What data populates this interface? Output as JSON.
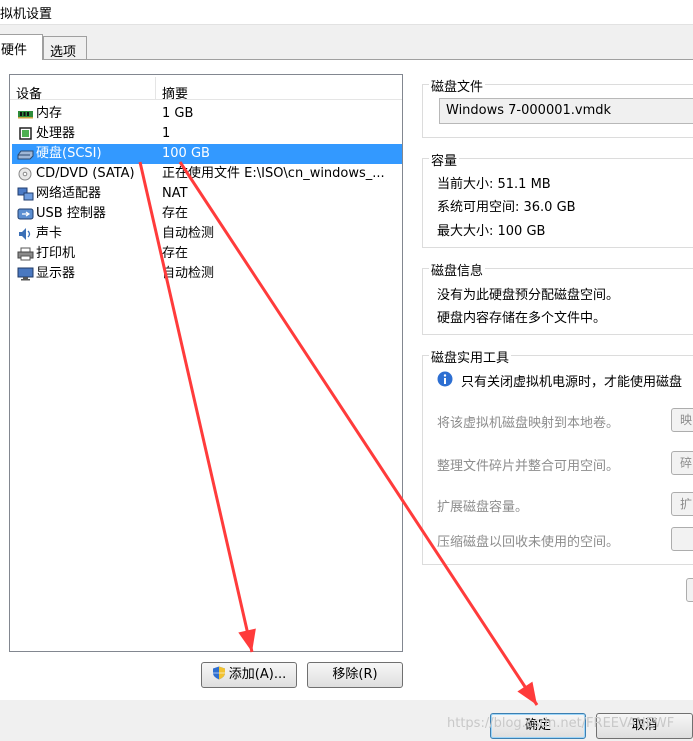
{
  "window": {
    "title": "拟机设置"
  },
  "tabs": [
    {
      "label": "硬件",
      "active": true
    },
    {
      "label": "选项",
      "active": false
    }
  ],
  "device_list": {
    "headers": {
      "device": "设备",
      "summary": "摘要"
    },
    "items": [
      {
        "icon": "memory-icon",
        "name": "内存",
        "summary": "1 GB"
      },
      {
        "icon": "processor-icon",
        "name": "处理器",
        "summary": "1"
      },
      {
        "icon": "hard-disk-icon",
        "name": "硬盘(SCSI)",
        "summary": "100 GB",
        "selected": true
      },
      {
        "icon": "cd-dvd-icon",
        "name": "CD/DVD (SATA)",
        "summary": "正在使用文件 E:\\ISO\\cn_windows_..."
      },
      {
        "icon": "network-adapter-icon",
        "name": "网络适配器",
        "summary": "NAT"
      },
      {
        "icon": "usb-controller-icon",
        "name": "USB 控制器",
        "summary": "存在"
      },
      {
        "icon": "sound-card-icon",
        "name": "声卡",
        "summary": "自动检测"
      },
      {
        "icon": "printer-icon",
        "name": "打印机",
        "summary": "存在"
      },
      {
        "icon": "display-icon",
        "name": "显示器",
        "summary": "自动检测"
      }
    ]
  },
  "buttons": {
    "add": "添加(A)...",
    "remove": "移除(R)",
    "ok": "确定",
    "cancel": "取消"
  },
  "disk_file": {
    "legend": "磁盘文件",
    "value": "Windows 7-000001.vmdk"
  },
  "capacity": {
    "legend": "容量",
    "current_size": "当前大小: 51.1 MB",
    "available": "系统可用空间: 36.0 GB",
    "max_size": "最大大小: 100 GB"
  },
  "disk_info": {
    "legend": "磁盘信息",
    "line1": "没有为此硬盘预分配磁盘空间。",
    "line2": "硬盘内容存储在多个文件中。"
  },
  "disk_tools": {
    "legend": "磁盘实用工具",
    "notice": "只有关闭虚拟机电源时，才能使用磁盘",
    "items": [
      {
        "label": "将该虚拟机磁盘映射到本地卷。",
        "button": "映"
      },
      {
        "label": "整理文件碎片并整合可用空间。",
        "button": "碎"
      },
      {
        "label": "扩展磁盘容量。",
        "button": "扩"
      },
      {
        "label": "压缩磁盘以回收未使用的空间。",
        "button": ""
      }
    ]
  },
  "watermark": "https://blog.csdn.net/FREEVANEWF",
  "colors": {
    "selection": "#3399ff",
    "arrow": "#ff3b3b"
  }
}
